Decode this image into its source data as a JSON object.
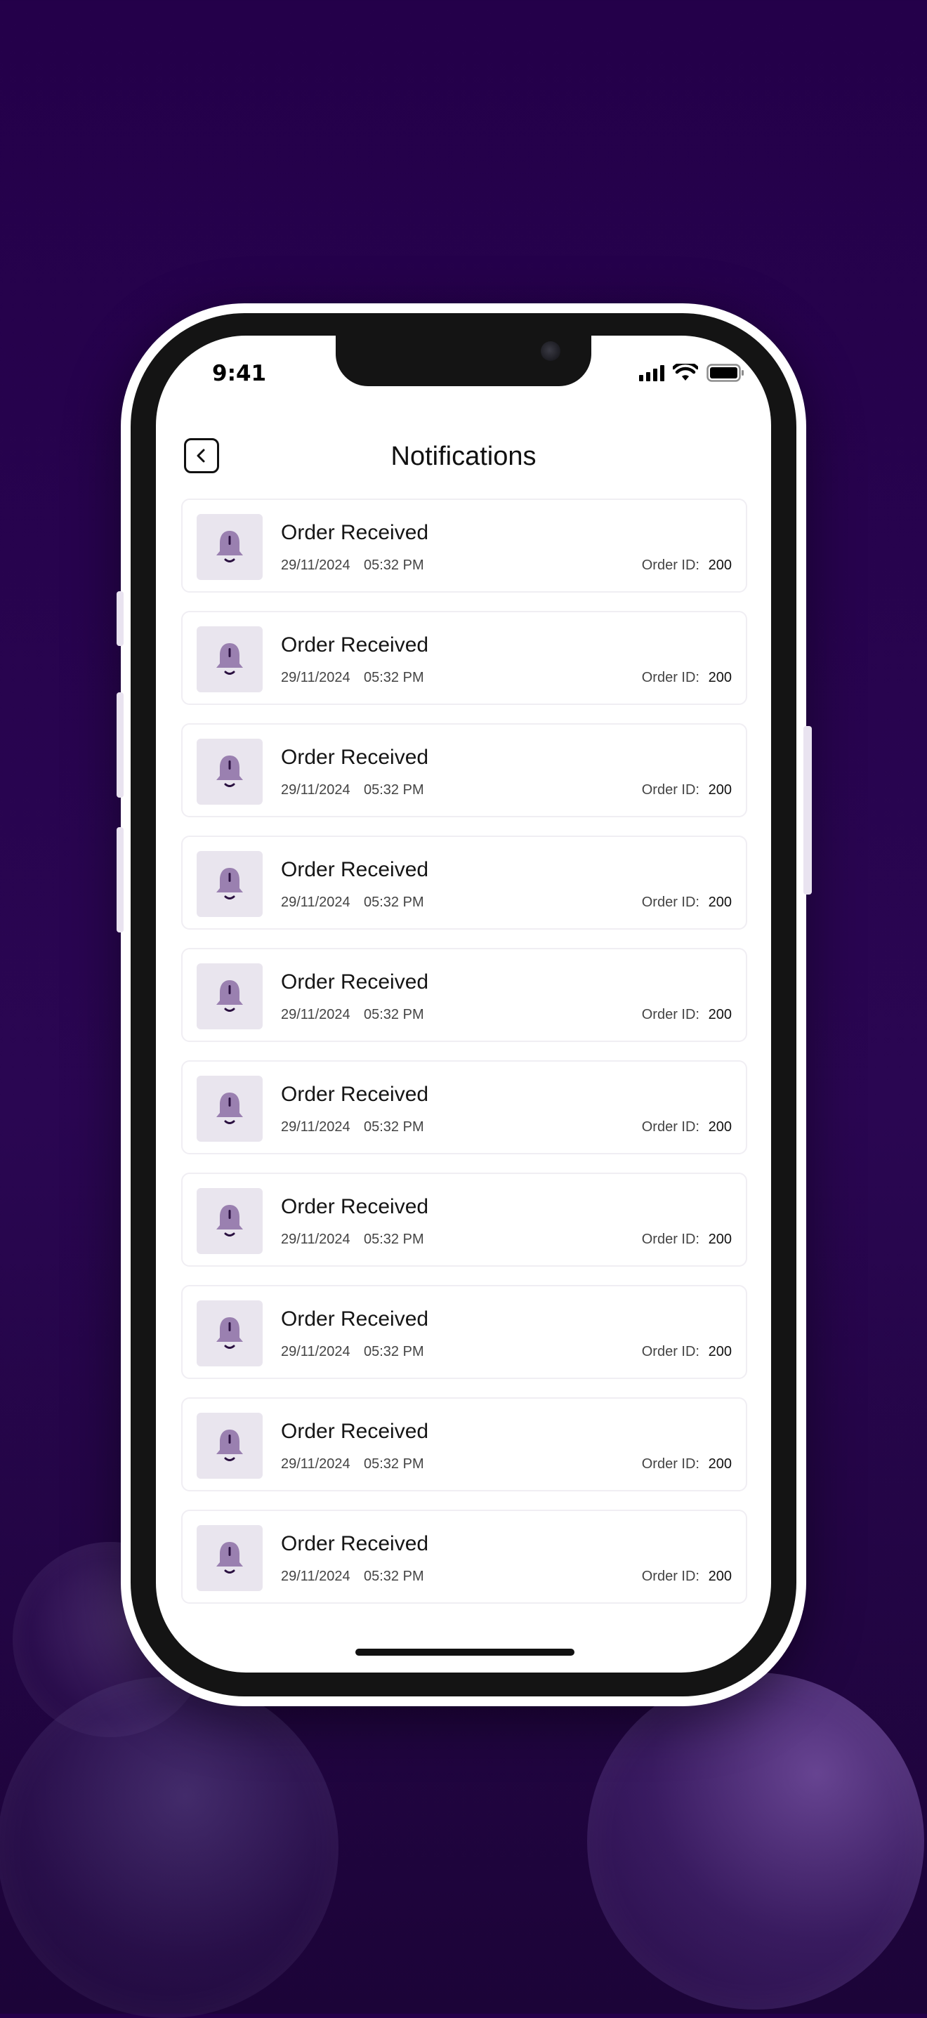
{
  "status_bar": {
    "time": "9:41"
  },
  "header": {
    "title": "Notifications"
  },
  "notifications": [
    {
      "title": "Order Received",
      "date": "29/11/2024",
      "time": "05:32 PM",
      "order_label": "Order ID:",
      "order_id": "200"
    },
    {
      "title": "Order Received",
      "date": "29/11/2024",
      "time": "05:32 PM",
      "order_label": "Order ID:",
      "order_id": "200"
    },
    {
      "title": "Order Received",
      "date": "29/11/2024",
      "time": "05:32 PM",
      "order_label": "Order ID:",
      "order_id": "200"
    },
    {
      "title": "Order Received",
      "date": "29/11/2024",
      "time": "05:32 PM",
      "order_label": "Order ID:",
      "order_id": "200"
    },
    {
      "title": "Order Received",
      "date": "29/11/2024",
      "time": "05:32 PM",
      "order_label": "Order ID:",
      "order_id": "200"
    },
    {
      "title": "Order Received",
      "date": "29/11/2024",
      "time": "05:32 PM",
      "order_label": "Order ID:",
      "order_id": "200"
    },
    {
      "title": "Order Received",
      "date": "29/11/2024",
      "time": "05:32 PM",
      "order_label": "Order ID:",
      "order_id": "200"
    },
    {
      "title": "Order Received",
      "date": "29/11/2024",
      "time": "05:32 PM",
      "order_label": "Order ID:",
      "order_id": "200"
    },
    {
      "title": "Order Received",
      "date": "29/11/2024",
      "time": "05:32 PM",
      "order_label": "Order ID:",
      "order_id": "200"
    },
    {
      "title": "Order Received",
      "date": "29/11/2024",
      "time": "05:32 PM",
      "order_label": "Order ID:",
      "order_id": "200"
    }
  ],
  "icons": {
    "back": "chevron-left-icon",
    "notification": "bell-icon"
  },
  "colors": {
    "background": "#24004a",
    "bell": "#9a80b0",
    "thumb_bg": "#e9e5ee"
  }
}
